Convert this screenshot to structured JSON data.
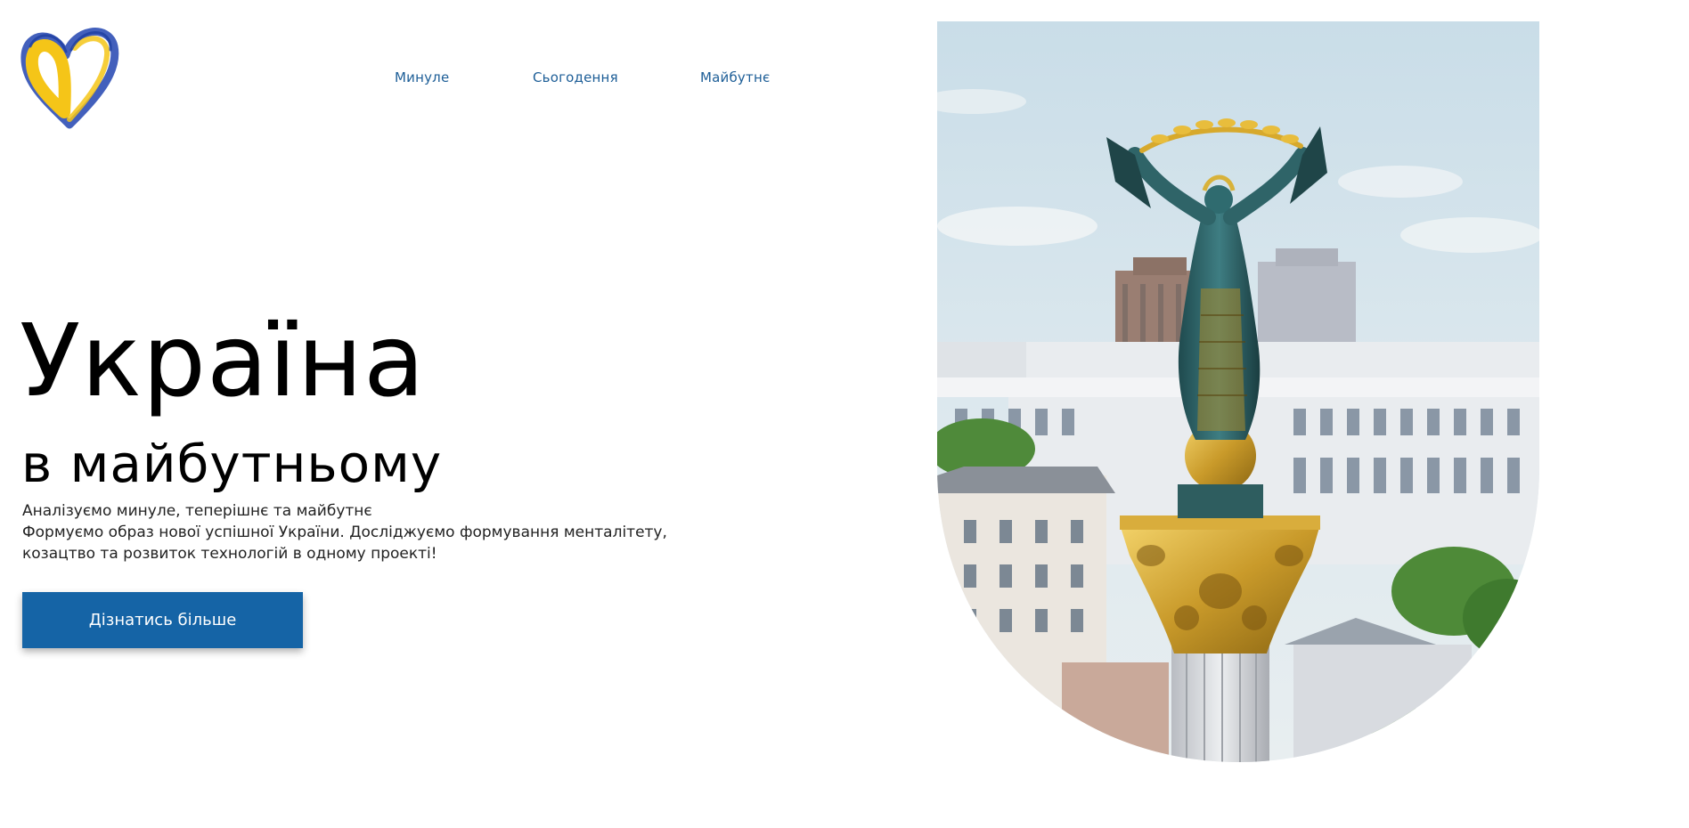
{
  "nav": {
    "items": [
      {
        "label": "Минуле"
      },
      {
        "label": "Сьогодення"
      },
      {
        "label": "Майбутнє"
      }
    ]
  },
  "hero": {
    "title": "Україна",
    "subtitle": "в майбутньому",
    "lines": [
      "Аналізуємо минуле, теперішнє та майбутнє",
      "Формуємо образ нової успішної України. Досліджуємо формування менталітету,",
      "козацтво та розвиток технологій в одному проекті!"
    ],
    "cta_label": "Дізнатись більше"
  },
  "colors": {
    "accent": "#1564a6",
    "nav_text": "#1d5e97",
    "logo_yellow": "#f5c518",
    "logo_blue": "#2f4fb5"
  },
  "icons": {
    "logo": "heart-logo-icon",
    "photo": "independence-monument-image"
  }
}
